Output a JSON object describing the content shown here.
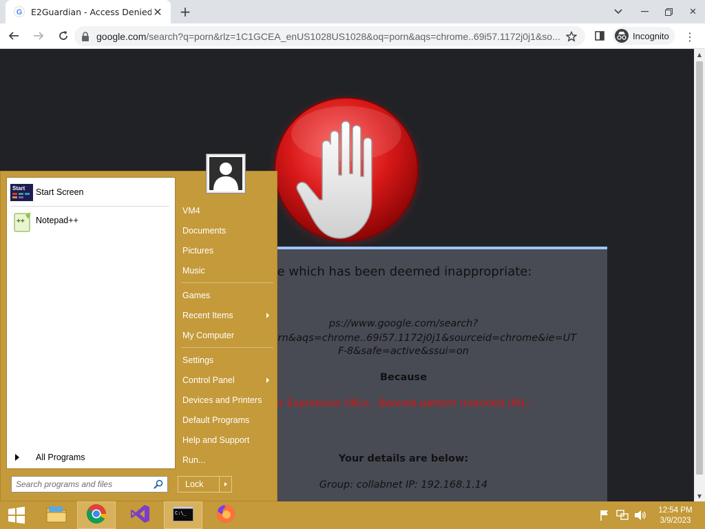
{
  "browser": {
    "tab_title": "E2Guardian - Access Denied",
    "url_host": "google.com",
    "url_rest": "/search?q=porn&rlz=1C1GCEA_enUS1028US1028&oq=porn&aqs=chrome..69i57.1172j0j1&so...",
    "incognito_label": "Incognito"
  },
  "page": {
    "line1": "g a website which has been deemed inappropriate:",
    "url_line1": "ps://www.google.com/search?",
    "url_line2": "8&oq=porn&aqs=chrome..69i57.1172j0j1&sourceid=chrome&ie=UT",
    "url_line3": "F-8&safe=active&ssui=on",
    "because": "Because",
    "reason": "ar Expression URLs : Banned pattern matched URL :",
    "details_title": "Your details are below:",
    "details": "Group: collabnet    IP: 192.168.1.14"
  },
  "start_menu": {
    "pinned": [
      {
        "label": "Start Screen",
        "icon": "start-screen-icon"
      },
      {
        "label": "Notepad++",
        "icon": "notepadpp-icon"
      }
    ],
    "all_programs": "All Programs",
    "search_placeholder": "Search programs and files",
    "right_items": [
      {
        "label": "VM4",
        "submenu": false
      },
      {
        "label": "Documents",
        "submenu": false
      },
      {
        "label": "Pictures",
        "submenu": false
      },
      {
        "label": "Music",
        "submenu": false
      },
      {
        "label": "Games",
        "submenu": false
      },
      {
        "label": "Recent Items",
        "submenu": true
      },
      {
        "label": "My Computer",
        "submenu": false
      },
      {
        "label": "Settings",
        "submenu": false
      },
      {
        "label": "Control Panel",
        "submenu": true
      },
      {
        "label": "Devices and Printers",
        "submenu": false
      },
      {
        "label": "Default Programs",
        "submenu": false
      },
      {
        "label": "Help and Support",
        "submenu": false
      },
      {
        "label": "Run...",
        "submenu": false
      }
    ],
    "lock_label": "Lock"
  },
  "taskbar": {
    "items": [
      "file-explorer-icon",
      "chrome-icon",
      "visual-studio-icon",
      "command-prompt-icon",
      "firefox-icon"
    ],
    "clock_time": "12:54 PM",
    "clock_date": "3/9/2023"
  },
  "colors": {
    "accent_gold": "#c49a3a",
    "page_bg": "#212226",
    "content_bg": "#484b54",
    "reason_red": "#e01010"
  }
}
